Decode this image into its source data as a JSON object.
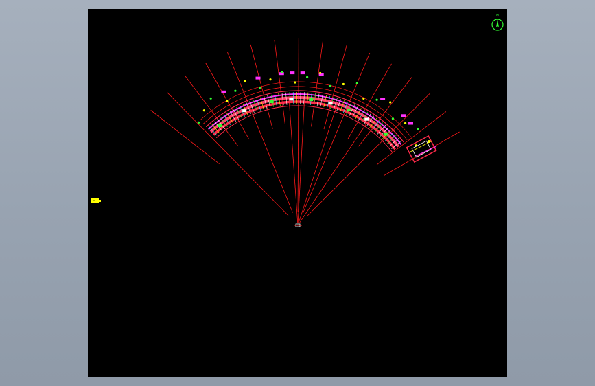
{
  "viewport": {
    "background": "#000000",
    "frame_background": "#9ba6b4"
  },
  "colors": {
    "radial_lines": "#ff1a1a",
    "road_band": "#ff2a4a",
    "magenta": "#ff33ff",
    "green": "#33ff33",
    "yellow": "#ffff00",
    "cyan": "#33ffff",
    "white": "#ffffff"
  },
  "drawing": {
    "type": "curved-road-plan",
    "radial_line_count": 16,
    "marker_count": 22,
    "label_tag_count": 9
  },
  "icons": {
    "north_arrow": "north-arrow-icon",
    "block": "yellow-block-icon"
  }
}
